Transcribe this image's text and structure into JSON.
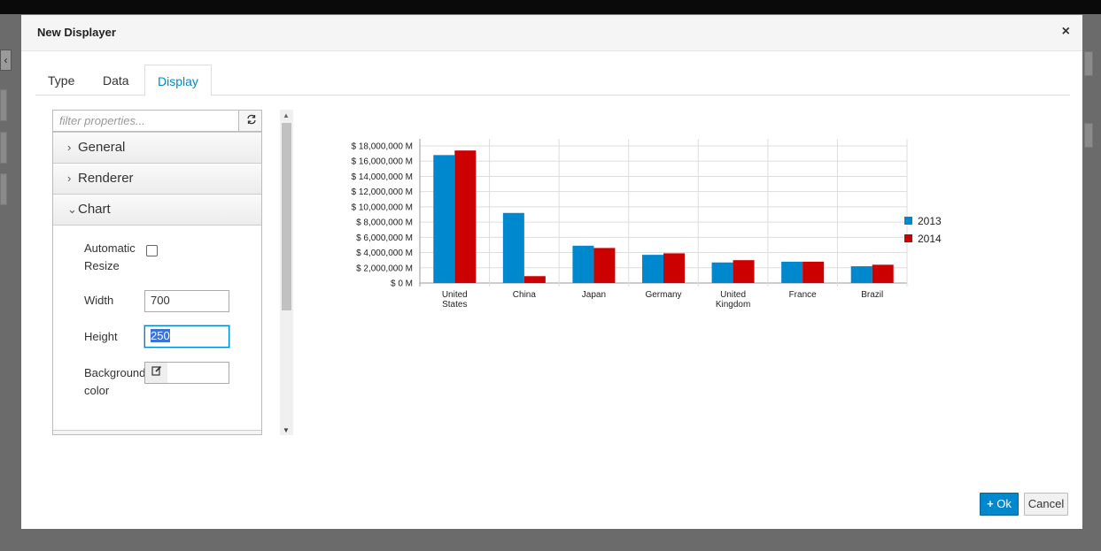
{
  "dialog": {
    "title": "New Displayer",
    "close_label": "×"
  },
  "tabs": [
    {
      "label": "Type"
    },
    {
      "label": "Data"
    },
    {
      "label": "Display",
      "active": true
    }
  ],
  "properties": {
    "filter_placeholder": "filter properties...",
    "sections": [
      {
        "label": "General",
        "expanded": false
      },
      {
        "label": "Renderer",
        "expanded": false
      },
      {
        "label": "Chart",
        "expanded": true
      }
    ],
    "chart": {
      "automatic_resize_label_1": "Automatic",
      "automatic_resize_label_2": "Resize",
      "automatic_resize_checked": false,
      "width_label": "Width",
      "width_value": "700",
      "height_label": "Height",
      "height_value": "250",
      "bg_color_label_1": "Background",
      "bg_color_label_2": "color",
      "bg_color_value": ""
    }
  },
  "footer": {
    "ok_label": "Ok",
    "cancel_label": "Cancel"
  },
  "colors": {
    "series_2013": "#0088ce",
    "series_2014": "#cc0000",
    "accent": "#0088ce"
  },
  "icons": {
    "refresh": "refresh-icon",
    "edit": "edit-icon",
    "plus": "plus-icon",
    "close": "close-icon"
  },
  "chart_data": {
    "type": "bar",
    "categories": [
      [
        "United",
        "States"
      ],
      [
        "China"
      ],
      [
        "Japan"
      ],
      [
        "Germany"
      ],
      [
        "United",
        "Kingdom"
      ],
      [
        "France"
      ],
      [
        "Brazil"
      ]
    ],
    "series": [
      {
        "name": "2013",
        "values": [
          16800000,
          9200000,
          4900000,
          3700000,
          2700000,
          2800000,
          2200000
        ]
      },
      {
        "name": "2014",
        "values": [
          17400000,
          900000,
          4600000,
          3900000,
          3000000,
          2800000,
          2400000
        ]
      }
    ],
    "yticks": [
      "$ 0 M",
      "$ 2,000,000 M",
      "$ 4,000,000 M",
      "$ 6,000,000 M",
      "$ 8,000,000 M",
      "$ 10,000,000 M",
      "$ 12,000,000 M",
      "$ 14,000,000 M",
      "$ 16,000,000 M",
      "$ 18,000,000 M"
    ],
    "ylim": [
      0,
      18000000
    ],
    "grid": true,
    "legend_position": "right"
  }
}
